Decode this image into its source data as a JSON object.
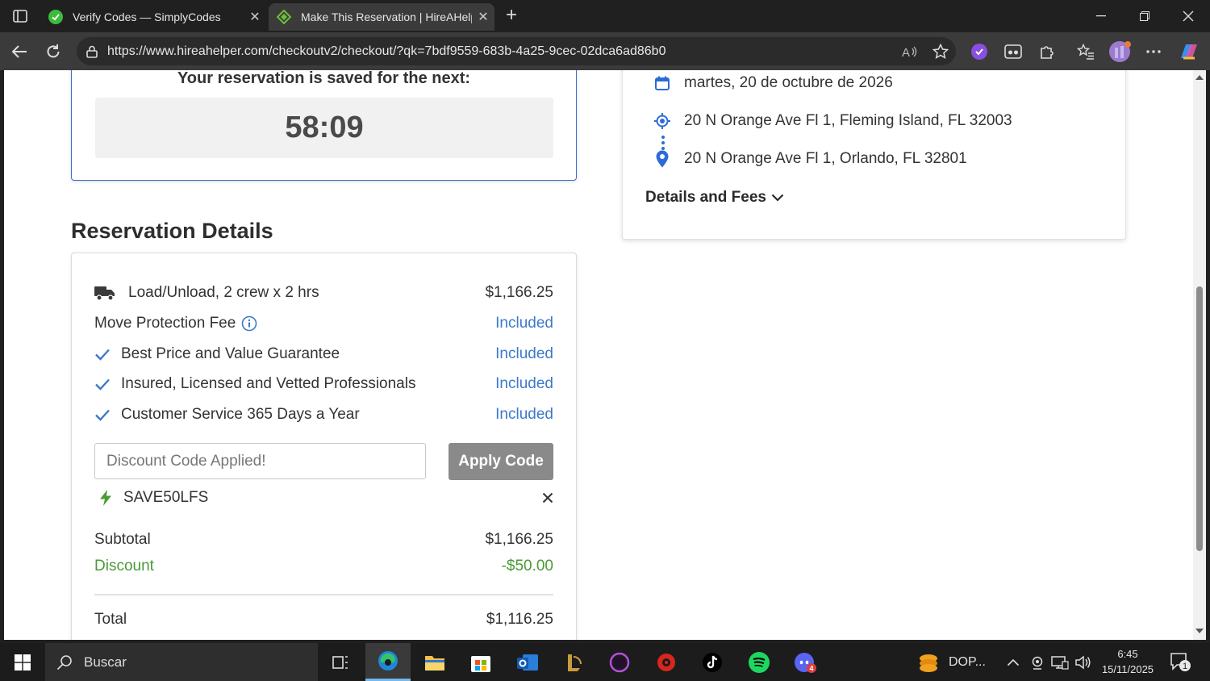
{
  "browser": {
    "tabs": [
      {
        "title": "Verify Codes — SimplyCodes",
        "active": false,
        "favicon": "simplycodes-icon"
      },
      {
        "title": "Make This Reservation | HireAHelper",
        "active": true,
        "favicon": "hireahelper-icon"
      }
    ],
    "url": "https://www.hireahelper.com/checkoutv2/checkout/?qk=7bdf9559-683b-4a25-9cec-02dca6ad86b0"
  },
  "page": {
    "timer": {
      "heading": "Your reservation is saved for the next:",
      "countdown": "58:09"
    },
    "route": {
      "date": "martes, 20 de octubre de 2026",
      "origin": "20 N Orange Ave Fl 1, Fleming Island, FL 32003",
      "destination": "20 N Orange Ave Fl 1, Orlando, FL 32801",
      "details_toggle": "Details and Fees"
    },
    "reservation": {
      "title": "Reservation Details",
      "service": {
        "label": "Load/Unload, 2 crew x 2 hrs",
        "price": "$1,166.25"
      },
      "protection": {
        "label": "Move Protection Fee",
        "value": "Included"
      },
      "guarantees": [
        {
          "label": "Best Price and Value Guarantee",
          "value": "Included"
        },
        {
          "label": "Insured, Licensed and Vetted Professionals",
          "value": "Included"
        },
        {
          "label": "Customer Service 365 Days a Year",
          "value": "Included"
        }
      ],
      "discount_placeholder": "Discount Code Applied!",
      "apply_label": "Apply Code",
      "coupon_code": "SAVE50LFS",
      "subtotal": {
        "label": "Subtotal",
        "value": "$1,166.25"
      },
      "discount": {
        "label": "Discount",
        "value": "-$50.00"
      },
      "total": {
        "label": "Total",
        "value": "$1,116.25"
      }
    }
  },
  "taskbar": {
    "search_placeholder": "Buscar",
    "notification_app": "DOP...",
    "time": "6:45",
    "date": "15/11/2025",
    "notification_count": "1",
    "discord_badge": "4"
  },
  "colors": {
    "included_blue": "#3d79c9",
    "discount_green": "#4a9a36",
    "accent_blue": "#2d6bd6",
    "apply_button_gray": "#8a8a8a"
  }
}
